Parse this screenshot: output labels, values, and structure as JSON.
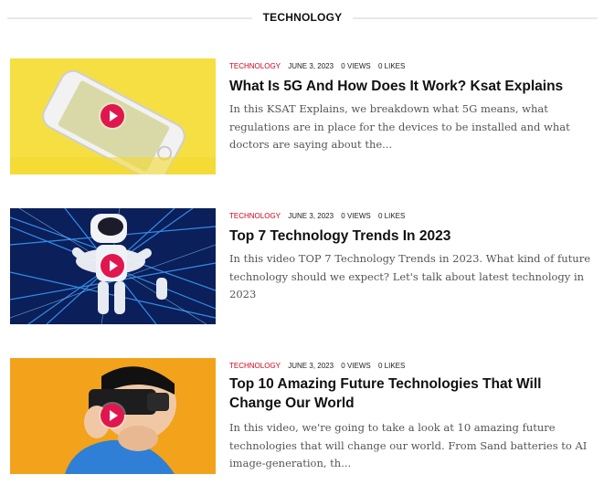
{
  "section": {
    "title": "TECHNOLOGY"
  },
  "posts": [
    {
      "category": "TECHNOLOGY",
      "date": "JUNE 3, 2023",
      "views": "0 VIEWS",
      "likes": "0 LIKES",
      "title": "What Is 5G And How Does It Work? Ksat Explains",
      "excerpt": "In this KSAT Explains, we breakdown what 5G means, what regulations are in place for the devices to be installed and what doctors are saying about the..."
    },
    {
      "category": "TECHNOLOGY",
      "date": "JUNE 3, 2023",
      "views": "0 VIEWS",
      "likes": "0 LIKES",
      "title": "Top 7 Technology Trends In 2023",
      "excerpt": "In this video TOP 7 Technology Trends in 2023. What kind of future technology should we expect? Let's talk about latest technology in 2023"
    },
    {
      "category": "TECHNOLOGY",
      "date": "JUNE 3, 2023",
      "views": "0 VIEWS",
      "likes": "0 LIKES",
      "title": "Top 10 Amazing Future Technologies That Will Change Our World",
      "excerpt": "In this video, we're going to take a look at 10 amazing future technologies that will change our world. From Sand batteries to AI image-generation, th..."
    }
  ],
  "colors": {
    "accent": "#e1164e",
    "category": "#d0021b"
  },
  "icons": {
    "play": "play-icon"
  }
}
